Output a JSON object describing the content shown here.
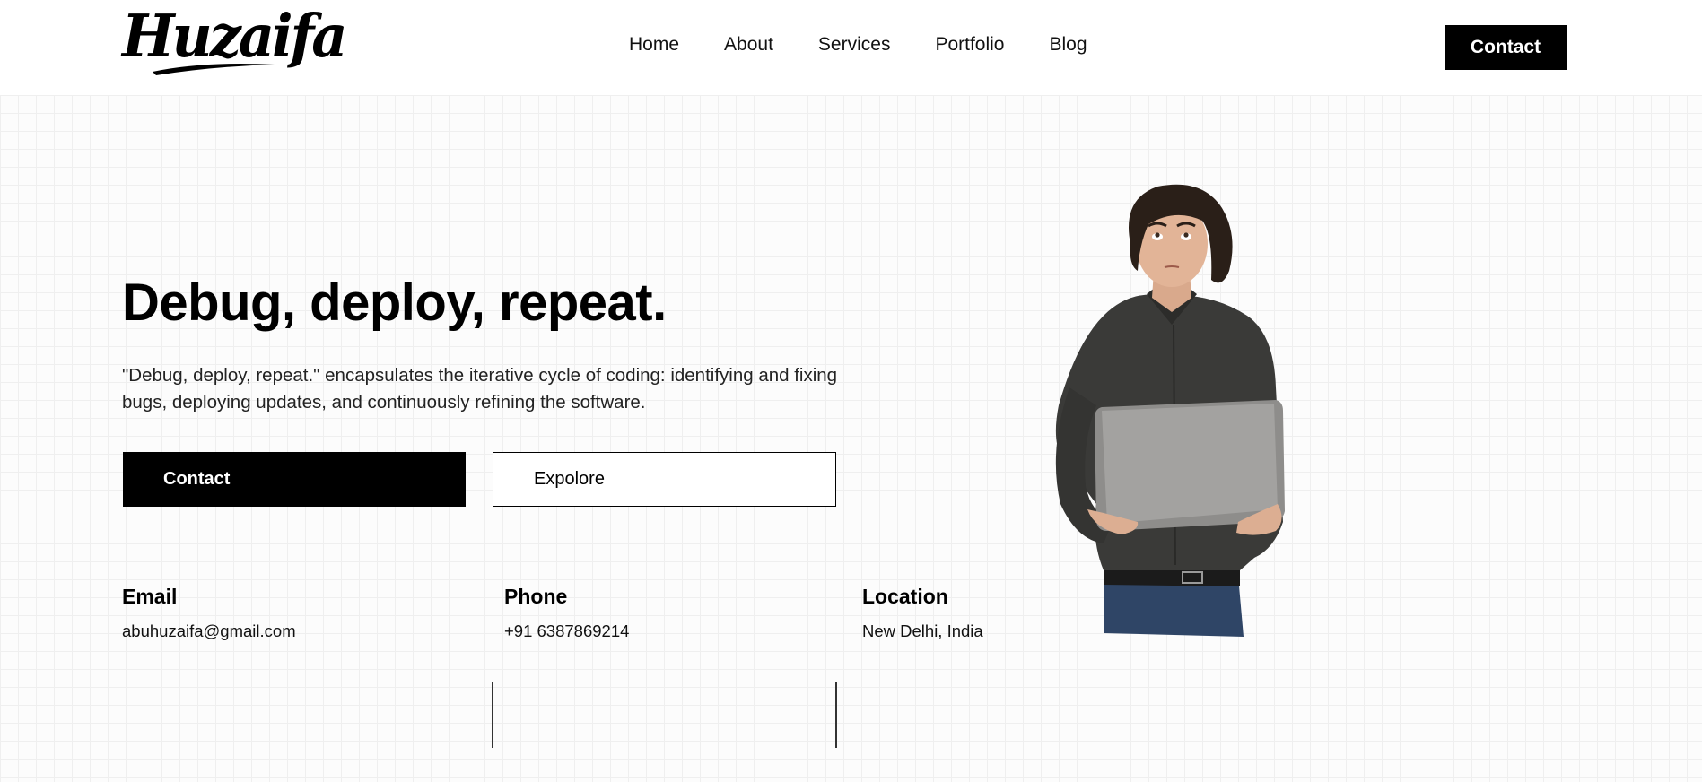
{
  "header": {
    "logo": "Huzaifa",
    "nav": [
      "Home",
      "About",
      "Services",
      "Portfolio",
      "Blog"
    ],
    "contact_label": "Contact"
  },
  "hero": {
    "title": "Debug, deploy, repeat.",
    "description": "\"Debug, deploy, repeat.\" encapsulates the iterative cycle of coding: identifying and fixing bugs, deploying updates, and continuously refining the software.",
    "primary_button": "Contact",
    "secondary_button": "Expolore"
  },
  "info": {
    "email": {
      "label": "Email",
      "value": "abuhuzaifa@gmail.com"
    },
    "phone": {
      "label": "Phone",
      "value": "+91 6387869214"
    },
    "location": {
      "label": "Location",
      "value": "New Delhi, India"
    }
  },
  "colors": {
    "primary": "#000000",
    "background": "#ffffff",
    "grid_line": "#efefef"
  }
}
